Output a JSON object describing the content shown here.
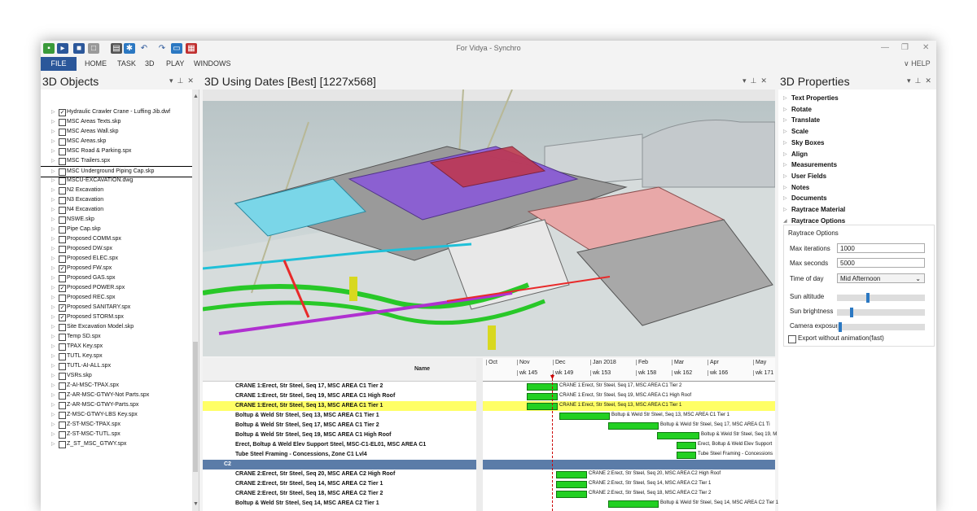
{
  "window": {
    "title": "For Vidya - Synchro"
  },
  "ribbon": {
    "file": "FILE",
    "tabs": [
      "HOME",
      "TASK",
      "3D",
      "PLAY",
      "WINDOWS"
    ],
    "help": "HELP"
  },
  "left_panel": {
    "title": "3D Objects",
    "items": [
      {
        "label": "Hydraulic Crawler Crane - Luffing Jib.dwf",
        "checked": true
      },
      {
        "label": "MSC Areas Texts.skp",
        "checked": false
      },
      {
        "label": "MSC Areas Wall.skp",
        "checked": false
      },
      {
        "label": "MSC Areas.skp",
        "checked": false
      },
      {
        "label": "MSC Road & Parking.spx",
        "checked": false
      },
      {
        "label": "MSC Trailers.spx",
        "checked": false
      },
      {
        "label": "MSC Underground Piping Cap.skp",
        "checked": false
      },
      {
        "label": "MSCU-EXCAVATION.dwg",
        "checked": false
      },
      {
        "label": "N2 Excavation",
        "checked": false
      },
      {
        "label": "N3 Excavation",
        "checked": false
      },
      {
        "label": "N4 Excavation",
        "checked": false
      },
      {
        "label": "NSWE.skp",
        "checked": false
      },
      {
        "label": "Pipe Cap.skp",
        "checked": false
      },
      {
        "label": "Proposed COMM.spx",
        "checked": false
      },
      {
        "label": "Proposed DW.spx",
        "checked": false
      },
      {
        "label": "Proposed ELEC.spx",
        "checked": false
      },
      {
        "label": "Proposed FW.spx",
        "checked": true
      },
      {
        "label": "Proposed GAS.spx",
        "checked": false
      },
      {
        "label": "Proposed POWER.spx",
        "checked": true
      },
      {
        "label": "Proposed REC.spx",
        "checked": false
      },
      {
        "label": "Proposed SANITARY.spx",
        "checked": true
      },
      {
        "label": "Proposed STORM.spx",
        "checked": true
      },
      {
        "label": "Site Excavation Model.skp",
        "checked": false
      },
      {
        "label": "Temp SD.spx",
        "checked": false
      },
      {
        "label": "TPAX Key.spx",
        "checked": false
      },
      {
        "label": "TUTL Key.spx",
        "checked": false
      },
      {
        "label": "TUTL-AI-ALL.spx",
        "checked": false
      },
      {
        "label": "VSRs.skp",
        "checked": false
      },
      {
        "label": "Z-AI-MSC-TPAX.spx",
        "checked": false
      },
      {
        "label": "Z-AR-MSC-GTWY-Not Parts.spx",
        "checked": false
      },
      {
        "label": "Z-AR-MSC-GTWY-Parts.spx",
        "checked": false
      },
      {
        "label": "Z-MSC-GTWY-LBS Key.spx",
        "checked": false
      },
      {
        "label": "Z-ST-MSC-TPAX.spx",
        "checked": false
      },
      {
        "label": "Z-ST-MSC-TUTL.spx",
        "checked": false
      },
      {
        "label": "Z_ST_MSC_GTWY.spx",
        "checked": false
      }
    ]
  },
  "viewport": {
    "title": "3D Using Dates [Best] [1227x568]"
  },
  "gantt": {
    "name_header": "Name",
    "months": [
      "Oct",
      "Nov",
      "Dec",
      "Jan 2018",
      "Feb",
      "Mar",
      "Apr",
      "May"
    ],
    "weeks": [
      "wk 145",
      "wk 149",
      "wk 153",
      "wk 158",
      "wk 162",
      "wk 166",
      "wk 171"
    ],
    "rows": [
      {
        "name": "CRANE 1:Erect, Str Steel, Seq 17,  MSC AREA C1 Tier 2"
      },
      {
        "name": "CRANE 1:Erect, Str Steel, Seq 19,  MSC AREA C1 High Roof"
      },
      {
        "name": "CRANE 1:Erect, Str Steel, Seq 13,  MSC AREA C1 Tier 1"
      },
      {
        "name": "Boltup & Weld Str Steel, Seq 13, MSC AREA C1 Tier 1"
      },
      {
        "name": "Boltup & Weld Str Steel, Seq 17, MSC AREA C1 Tier 2"
      },
      {
        "name": "Boltup & Weld Str Steel, Seq 19, MSC AREA C1 High Roof"
      },
      {
        "name": "Erect, Boltup & Weld Elev Support Steel, MSC-C1-EL01, MSC AREA C1"
      },
      {
        "name": "Tube Steel Framing - Concessions, Zone C1 Lvl4"
      },
      {
        "name": "C2"
      },
      {
        "name": "CRANE 2:Erect, Str Steel, Seq 20,  MSC AREA C2 High Roof"
      },
      {
        "name": "CRANE 2:Erect, Str Steel, Seq 14,  MSC AREA C2 Tier 1"
      },
      {
        "name": "CRANE 2:Erect, Str Steel, Seq 18,  MSC AREA C2 Tier 2"
      },
      {
        "name": "Boltup & Weld Str Steel, Seq 14, MSC AREA C2 Tier 1"
      }
    ],
    "bar_labels": [
      "CRANE 1:Erect, Str Steel, Seq 17,  MSC AREA C1 Tier 2",
      "CRANE 1:Erect, Str Steel, Seq 19,  MSC AREA C1 High Roof",
      "CRANE 1:Erect, Str Steel, Seq 13,  MSC AREA C1 Tier 1",
      "Boltup & Weld Str Steel, Seq 13, MSC AREA C1 Tier 1",
      "Boltup & Weld Str Steel, Seq 17, MSC AREA C1 Ti",
      "Boltup & Weld Str Steel, Seq 19, M",
      "Erect, Boltup & Weld Elev Support",
      "Tube Steel Framing - Concessions",
      "",
      "CRANE 2:Erect, Str Steel, Seq 20,  MSC AREA C2 High Roof",
      "CRANE 2:Erect, Str Steel, Seq 14,  MSC AREA C2 Tier 1",
      "CRANE 2:Erect, Str Steel, Seq 18,  MSC AREA C2 Tier 2",
      "Boltup & Weld Str Steel, Seq 14, MSC AREA C2 Tier 1"
    ]
  },
  "right_panel": {
    "title": "3D Properties",
    "sections": [
      "Text Properties",
      "Rotate",
      "Translate",
      "Scale",
      "Sky Boxes",
      "Align",
      "Measurements",
      "User Fields",
      "Notes",
      "Documents",
      "Raytrace Material",
      "Raytrace Options"
    ],
    "raytrace": {
      "group_label": "Raytrace Options",
      "max_iterations_label": "Max iterations",
      "max_iterations": "1000",
      "max_seconds_label": "Max seconds",
      "max_seconds": "5000",
      "time_of_day_label": "Time of day",
      "time_of_day": "Mid Afternoon",
      "sun_altitude_label": "Sun altitude",
      "sun_brightness_label": "Sun brightness",
      "camera_exposure_label": "Camera exposure",
      "export_label": "Export without animation(fast)"
    }
  },
  "colors": {
    "accent": "#2b579a",
    "bar": "#22d022",
    "selected_row": "#ffff66",
    "group_row": "#5b7ca8"
  }
}
